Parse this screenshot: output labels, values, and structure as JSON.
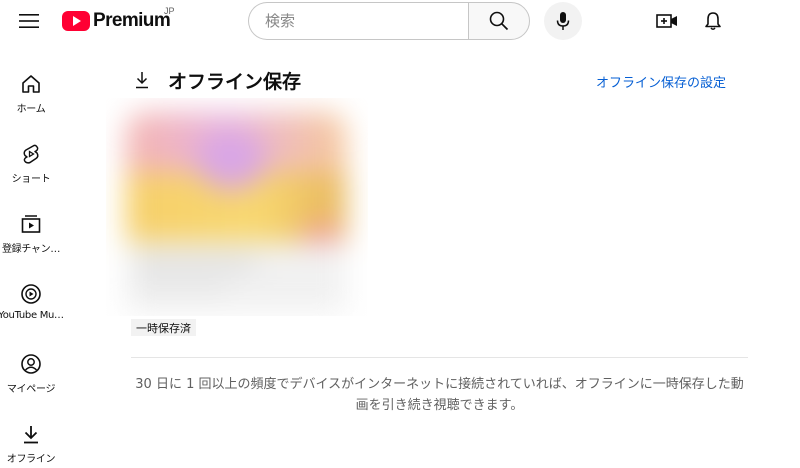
{
  "header": {
    "logo_text": "Premium",
    "logo_region": "JP",
    "search_placeholder": "検索"
  },
  "sidebar": {
    "items": [
      {
        "label": "ホーム",
        "icon": "home-icon"
      },
      {
        "label": "ショート",
        "icon": "shorts-icon"
      },
      {
        "label": "登録チャン…",
        "icon": "subscriptions-icon"
      },
      {
        "label": "YouTube Mu…",
        "icon": "youtube-music-icon"
      },
      {
        "label": "マイページ",
        "icon": "account-icon"
      },
      {
        "label": "オフライン",
        "icon": "download-icon"
      }
    ]
  },
  "main": {
    "title": "オフライン保存",
    "settings_link": "オフライン保存の設定",
    "video": {
      "badge": "一時保存済"
    },
    "info_text": "30 日に 1 回以上の頻度でデバイスがインターネットに接続されていれば、オフラインに一時保存した動画を引き続き視聴できます。"
  },
  "colors": {
    "brand_red": "#ff0033",
    "link_blue": "#065fd4",
    "text_secondary": "#606060"
  }
}
